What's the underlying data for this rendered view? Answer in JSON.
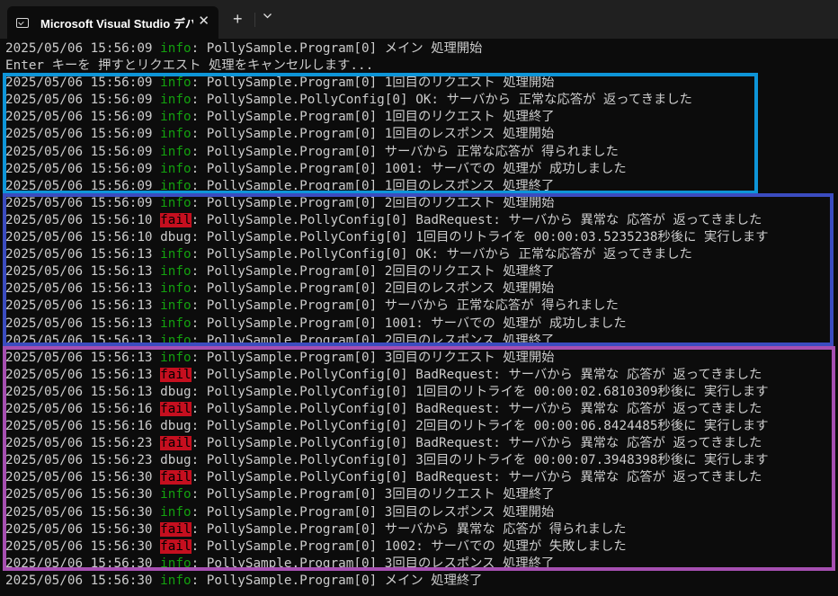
{
  "window": {
    "tab_title": "Microsoft Visual Studio デバック",
    "close_glyph": "✕",
    "new_tab_glyph": "+"
  },
  "colors": {
    "info": "#13a10e",
    "fail_bg": "#c50f1f",
    "box_1": "#0e95d8",
    "box_2": "#3b4cc0",
    "box_3": "#a64fb1"
  },
  "console": {
    "lines": [
      {
        "ts": "2025/05/06 15:56:09 ",
        "level": "info",
        "msg": ": PollySample.Program[0] メイン 処理開始"
      },
      {
        "ts": "",
        "level": "",
        "msg": "Enter キーを 押すとリクエスト 処理をキャンセルします..."
      },
      {
        "ts": "2025/05/06 15:56:09 ",
        "level": "info",
        "msg": ": PollySample.Program[0] 1回目のリクエスト 処理開始"
      },
      {
        "ts": "2025/05/06 15:56:09 ",
        "level": "info",
        "msg": ": PollySample.PollyConfig[0] OK: サーバから 正常な応答が 返ってきました"
      },
      {
        "ts": "2025/05/06 15:56:09 ",
        "level": "info",
        "msg": ": PollySample.Program[0] 1回目のリクエスト 処理終了"
      },
      {
        "ts": "2025/05/06 15:56:09 ",
        "level": "info",
        "msg": ": PollySample.Program[0] 1回目のレスポンス 処理開始"
      },
      {
        "ts": "2025/05/06 15:56:09 ",
        "level": "info",
        "msg": ": PollySample.Program[0] サーバから 正常な応答が 得られました"
      },
      {
        "ts": "2025/05/06 15:56:09 ",
        "level": "info",
        "msg": ": PollySample.Program[0] 1001: サーバでの 処理が 成功しました"
      },
      {
        "ts": "2025/05/06 15:56:09 ",
        "level": "info",
        "msg": ": PollySample.Program[0] 1回目のレスポンス 処理終了"
      },
      {
        "ts": "2025/05/06 15:56:09 ",
        "level": "info",
        "msg": ": PollySample.Program[0] 2回目のリクエスト 処理開始"
      },
      {
        "ts": "2025/05/06 15:56:10 ",
        "level": "fail",
        "msg": ": PollySample.PollyConfig[0] BadRequest: サーバから 異常な 応答が 返ってきました"
      },
      {
        "ts": "2025/05/06 15:56:10 ",
        "level": "dbug",
        "msg": ": PollySample.PollyConfig[0] 1回目のリトライを 00:00:03.5235238秒後に 実行します"
      },
      {
        "ts": "2025/05/06 15:56:13 ",
        "level": "info",
        "msg": ": PollySample.PollyConfig[0] OK: サーバから 正常な応答が 返ってきました"
      },
      {
        "ts": "2025/05/06 15:56:13 ",
        "level": "info",
        "msg": ": PollySample.Program[0] 2回目のリクエスト 処理終了"
      },
      {
        "ts": "2025/05/06 15:56:13 ",
        "level": "info",
        "msg": ": PollySample.Program[0] 2回目のレスポンス 処理開始"
      },
      {
        "ts": "2025/05/06 15:56:13 ",
        "level": "info",
        "msg": ": PollySample.Program[0] サーバから 正常な応答が 得られました"
      },
      {
        "ts": "2025/05/06 15:56:13 ",
        "level": "info",
        "msg": ": PollySample.Program[0] 1001: サーバでの 処理が 成功しました"
      },
      {
        "ts": "2025/05/06 15:56:13 ",
        "level": "info",
        "msg": ": PollySample.Program[0] 2回目のレスポンス 処理終了"
      },
      {
        "ts": "2025/05/06 15:56:13 ",
        "level": "info",
        "msg": ": PollySample.Program[0] 3回目のリクエスト 処理開始"
      },
      {
        "ts": "2025/05/06 15:56:13 ",
        "level": "fail",
        "msg": ": PollySample.PollyConfig[0] BadRequest: サーバから 異常な 応答が 返ってきました"
      },
      {
        "ts": "2025/05/06 15:56:13 ",
        "level": "dbug",
        "msg": ": PollySample.PollyConfig[0] 1回目のリトライを 00:00:02.6810309秒後に 実行します"
      },
      {
        "ts": "2025/05/06 15:56:16 ",
        "level": "fail",
        "msg": ": PollySample.PollyConfig[0] BadRequest: サーバから 異常な 応答が 返ってきました"
      },
      {
        "ts": "2025/05/06 15:56:16 ",
        "level": "dbug",
        "msg": ": PollySample.PollyConfig[0] 2回目のリトライを 00:00:06.8424485秒後に 実行します"
      },
      {
        "ts": "2025/05/06 15:56:23 ",
        "level": "fail",
        "msg": ": PollySample.PollyConfig[0] BadRequest: サーバから 異常な 応答が 返ってきました"
      },
      {
        "ts": "2025/05/06 15:56:23 ",
        "level": "dbug",
        "msg": ": PollySample.PollyConfig[0] 3回目のリトライを 00:00:07.3948398秒後に 実行します"
      },
      {
        "ts": "2025/05/06 15:56:30 ",
        "level": "fail",
        "msg": ": PollySample.PollyConfig[0] BadRequest: サーバから 異常な 応答が 返ってきました"
      },
      {
        "ts": "2025/05/06 15:56:30 ",
        "level": "info",
        "msg": ": PollySample.Program[0] 3回目のリクエスト 処理終了"
      },
      {
        "ts": "2025/05/06 15:56:30 ",
        "level": "info",
        "msg": ": PollySample.Program[0] 3回目のレスポンス 処理開始"
      },
      {
        "ts": "2025/05/06 15:56:30 ",
        "level": "fail",
        "msg": ": PollySample.Program[0] サーバから 異常な 応答が 得られました"
      },
      {
        "ts": "2025/05/06 15:56:30 ",
        "level": "fail",
        "msg": ": PollySample.Program[0] 1002: サーバでの 処理が 失敗しました"
      },
      {
        "ts": "2025/05/06 15:56:30 ",
        "level": "info",
        "msg": ": PollySample.Program[0] 3回目のレスポンス 処理終了"
      },
      {
        "ts": "2025/05/06 15:56:30 ",
        "level": "info",
        "msg": ": PollySample.Program[0] メイン 処理終了"
      }
    ]
  }
}
